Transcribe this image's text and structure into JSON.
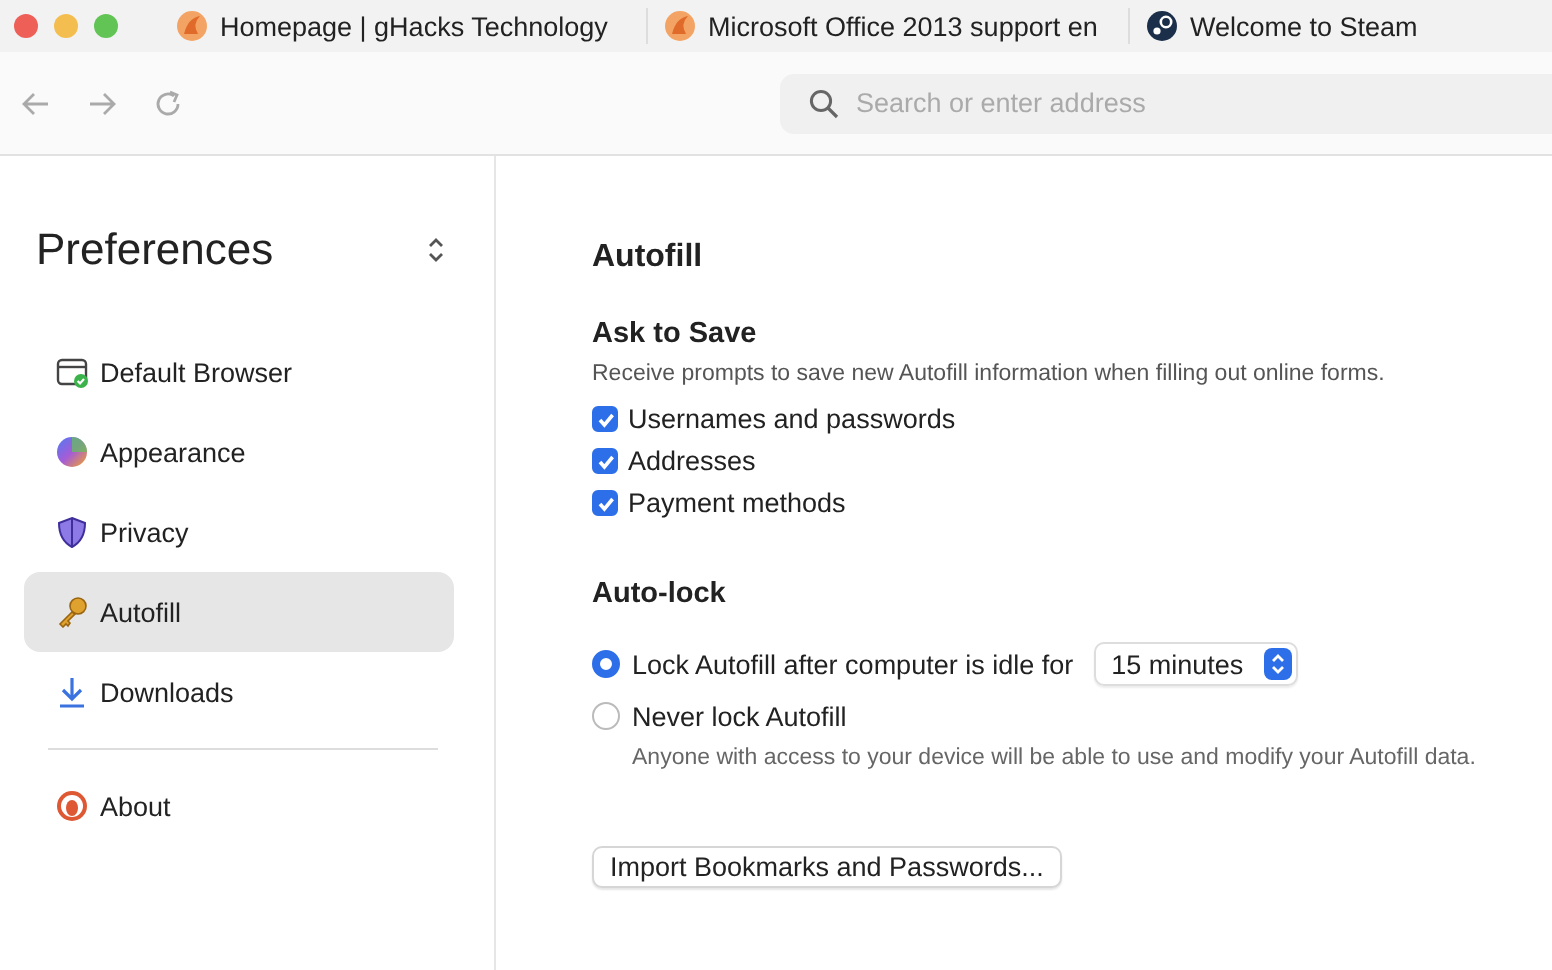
{
  "tabs": [
    {
      "title": "Homepage | gHacks Technology"
    },
    {
      "title": "Microsoft Office 2013 support en"
    },
    {
      "title": "Welcome to Steam"
    }
  ],
  "address_bar": {
    "placeholder": "Search or enter address"
  },
  "sidebar": {
    "title": "Preferences",
    "sections": [
      {
        "items": [
          {
            "label": "Default Browser",
            "selected": false
          },
          {
            "label": "Appearance",
            "selected": false
          },
          {
            "label": "Privacy",
            "selected": false
          },
          {
            "label": "Autofill",
            "selected": true
          },
          {
            "label": "Downloads",
            "selected": false
          }
        ]
      },
      {
        "items": [
          {
            "label": "About",
            "selected": false
          }
        ]
      }
    ]
  },
  "content": {
    "title": "Autofill",
    "ask_to_save": {
      "heading": "Ask to Save",
      "description": "Receive prompts to save new Autofill information when filling out online forms.",
      "options": [
        {
          "label": "Usernames and passwords",
          "checked": true
        },
        {
          "label": "Addresses",
          "checked": true
        },
        {
          "label": "Payment methods",
          "checked": true
        }
      ]
    },
    "auto_lock": {
      "heading": "Auto-lock",
      "options": [
        {
          "label": "Lock Autofill after computer is idle for",
          "selected": true,
          "dropdown": "15 minutes"
        },
        {
          "label": "Never lock Autofill",
          "selected": false,
          "note": "Anyone with access to your device will be able to use and modify your Autofill data."
        }
      ]
    },
    "import_button": "Import Bookmarks and Passwords..."
  }
}
